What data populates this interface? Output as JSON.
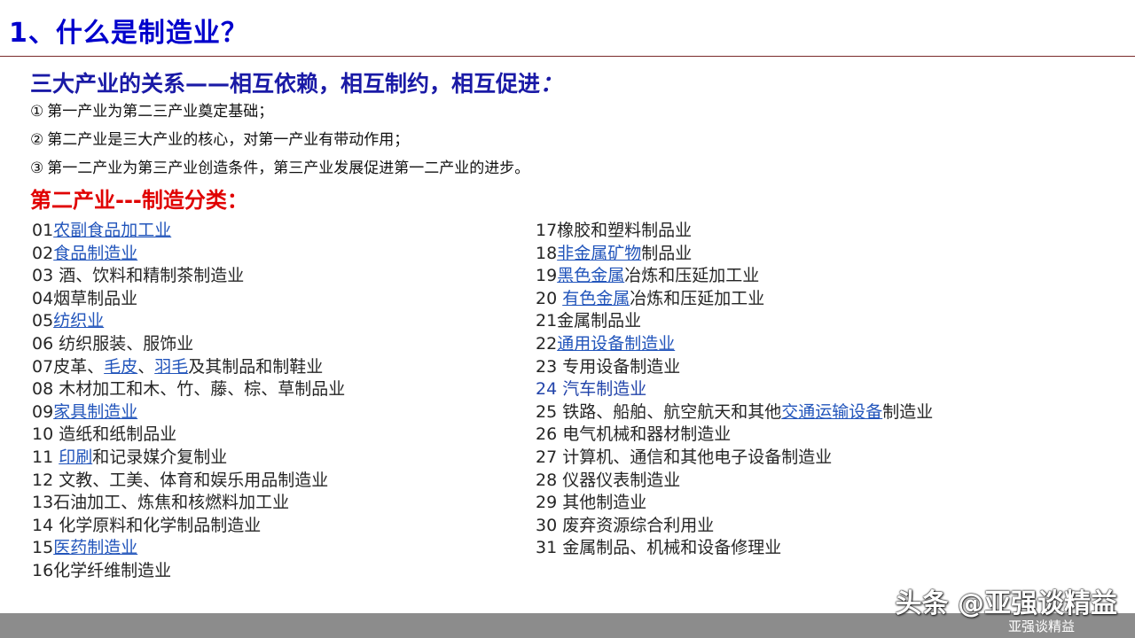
{
  "title": "1、什么是制造业？",
  "subtitle": {
    "text": "三大产业的关系——相互依赖，相互制约，相互促进",
    "colon": "："
  },
  "points": [
    {
      "num": "①",
      "text": "第一产业为第二三产业奠定基础；"
    },
    {
      "num": "②",
      "text": "第二产业是三大产业的核心，对第一产业有带动作用；"
    },
    {
      "num": "③",
      "text": "第一二产业为第三产业创造条件，第三产业发展促进第一二产业的进步。"
    }
  ],
  "section_heading": "第二产业---制造分类：",
  "left_list": [
    {
      "prefix": "01",
      "link": "农副食品加工业",
      "suffix": ""
    },
    {
      "prefix": "02",
      "link": "食品制造业",
      "suffix": ""
    },
    {
      "prefix": "03 酒、饮料和精制茶制造业"
    },
    {
      "prefix": "04烟草制品业"
    },
    {
      "prefix": "05",
      "link": "纺织业",
      "suffix": ""
    },
    {
      "prefix": "06 纺织服装、服饰业"
    },
    {
      "prefix": "07皮革、",
      "link": "毛皮",
      "mid": "、",
      "link2": "羽毛",
      "suffix": "及其制品和制鞋业"
    },
    {
      "prefix": "08 木材加工和木、竹、藤、棕、草制品业"
    },
    {
      "prefix": "09",
      "link": "家具制造业",
      "suffix": ""
    },
    {
      "prefix": "10 造纸和纸制品业"
    },
    {
      "prefix": "11 ",
      "link": "印刷",
      "suffix": "和记录媒介复制业"
    },
    {
      "prefix": "12 文教、工美、体育和娱乐用品制造业"
    },
    {
      "prefix": "13石油加工、炼焦和核燃料加工业"
    },
    {
      "prefix": "14 化学原料和化学制品制造业"
    },
    {
      "prefix": "15",
      "link": "医药制造业",
      "suffix": ""
    },
    {
      "prefix": "16化学纤维制造业"
    }
  ],
  "right_list": [
    {
      "prefix": "17橡胶和塑料制品业"
    },
    {
      "prefix": "18",
      "link": "非金属矿物",
      "suffix": "制品业"
    },
    {
      "prefix": "19",
      "link": "黑色金属",
      "suffix": "冶炼和压延加工业"
    },
    {
      "prefix": "20 ",
      "link": "有色金属",
      "suffix": "冶炼和压延加工业"
    },
    {
      "prefix": "21金属制品业"
    },
    {
      "prefix": "22",
      "link": "通用设备制造业",
      "suffix": ""
    },
    {
      "prefix": "23 专用设备制造业"
    },
    {
      "prefix": "24 汽车制造业"
    },
    {
      "prefix": "25 铁路、船舶、航空航天和其他",
      "link": "交通运输设备",
      "suffix": "制造业"
    },
    {
      "prefix": "26 电气机械和器材制造业"
    },
    {
      "prefix": "27 计算机、通信和其他电子设备制造业"
    },
    {
      "prefix": "28 仪器仪表制造业"
    },
    {
      "prefix": "29 其他制造业"
    },
    {
      "prefix": "30 废弃资源综合利用业"
    },
    {
      "prefix": "31 金属制品、机械和设备修理业"
    }
  ],
  "watermark": {
    "main": "头条 @亚强谈精益",
    "sub": "亚强谈精益"
  },
  "colors": {
    "title": "#0000cc",
    "subtitle": "#1a1aa6",
    "section": "#e00000",
    "link": "#2255bb",
    "rule": "#7a2a2a",
    "bottom_bar": "#8c8c8c"
  }
}
